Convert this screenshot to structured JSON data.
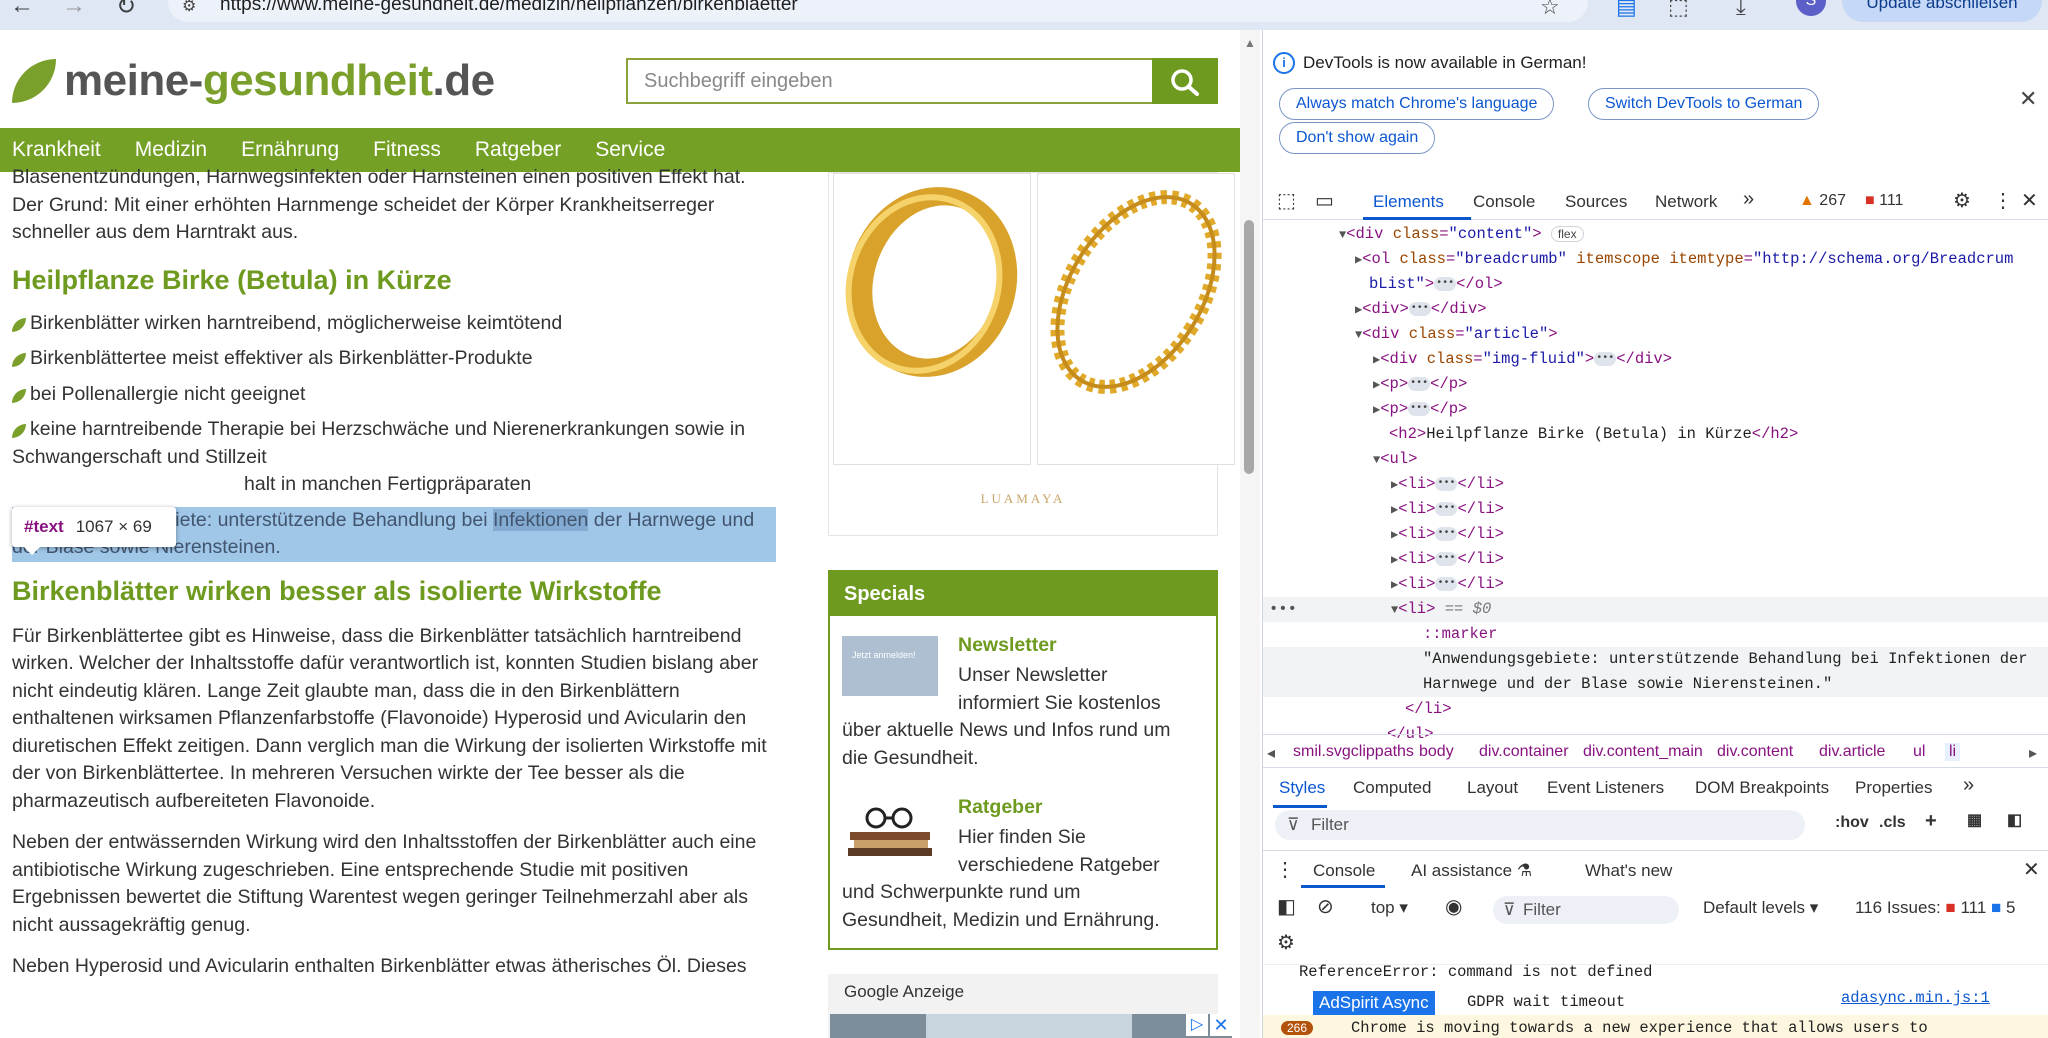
{
  "browser": {
    "url": "https://www.meine-gesundheit.de/medizin/heilpflanzen/birkenblaetter",
    "profile_initial": "S",
    "update_label": "Update abschließen"
  },
  "site": {
    "logo_a": "meine-",
    "logo_b": "gesundheit",
    "logo_c": ".de",
    "search_placeholder": "Suchbegriff eingeben",
    "nav": [
      "Krankheit",
      "Medizin",
      "Ernährung",
      "Fitness",
      "Ratgeber",
      "Service"
    ]
  },
  "article": {
    "intro_lines": [
      "Blasenentzündungen, Harnwegsinfekten oder Harnsteinen einen positiven Effekt hat.",
      "Der Grund: Mit einer erhöhten Harnmenge scheidet der Körper Krankheitserreger",
      "schneller aus dem Harntrakt aus."
    ],
    "h2_summary": "Heilpflanze Birke (Betula) in Kürze",
    "bullets": [
      "Birkenblätter wirken harntreibend, möglicherweise keimtötend",
      "Birkenblättertee meist effektiver als Birkenblätter-Produkte",
      "bei Pollenallergie nicht geeignet",
      "keine harntreibende Therapie bei Herzschwäche und Nierenerkrankungen sowie in",
      "Schwangerschaft und Stillzeit",
      "halt in manchen Fertigpräparaten"
    ],
    "highlighted_1_pre": "Anwendungsgebiete: unterstützende Behandlung bei ",
    "highlighted_1_word": "Infektionen",
    "highlighted_1_post": " der Harnwege und",
    "highlighted_2": "der Blase sowie Nierensteinen.",
    "h2_better": "Birkenblätter wirken besser als isolierte Wirkstoffe",
    "para1": [
      "Für Birkenblättertee gibt es Hinweise, dass die Birkenblätter tatsächlich harntreibend",
      "wirken. Welcher der Inhaltsstoffe dafür verantwortlich ist, konnten Studien bislang aber",
      "nicht eindeutig klären. Lange Zeit glaubte man, dass die in den Birkenblättern",
      "enthaltenen wirksamen Pflanzenfarbstoffe (Flavonoide) Hyperosid und Avicularin den",
      "diuretischen Effekt zeitigen. Dann verglich man die Wirkung der isolierten Wirkstoffe mit",
      "der von Birkenblättertee. In mehreren Versuchen wirkte der Tee besser als die",
      "pharmazeutisch aufbereiteten Flavonoide."
    ],
    "para2": [
      "Neben der entwässernden Wirkung wird den Inhaltsstoffen der Birkenblätter auch eine",
      "antibiotische Wirkung zugeschrieben. Eine entsprechende Studie mit positiven",
      "Ergebnissen bewertet die Stiftung Warentest wegen geringer Teilnehmerzahl aber als",
      "nicht aussagekräftig genug."
    ],
    "para3": "Neben Hyperosid und Avicularin enthalten Birkenblätter etwas ätherisches Öl. Dieses"
  },
  "tooltip": {
    "tag": "#text",
    "dims": "1067 × 69"
  },
  "sidebar": {
    "ad_brand": "LUAMAYA",
    "specials_title": "Specials",
    "newsletter_title": "Newsletter",
    "newsletter_thumb_text": "Jetzt anmelden!",
    "newsletter_text": [
      "Unser Newsletter",
      "informiert Sie kostenlos",
      "über aktuelle News und Infos rund um",
      "die Gesundheit."
    ],
    "ratgeber_title": "Ratgeber",
    "ratgeber_text": [
      "Hier finden Sie",
      "verschiedene Ratgeber",
      "und Schwerpunkte rund um",
      "Gesundheit, Medizin und Ernährung."
    ],
    "google_label": "Google Anzeige"
  },
  "devtools": {
    "info": "DevTools is now available in German!",
    "pill_1": "Always match Chrome's language",
    "pill_2": "Switch DevTools to German",
    "pill_3": "Don't show again",
    "tabs": [
      "Elements",
      "Console",
      "Sources",
      "Network"
    ],
    "warn_count": "267",
    "err_count": "111",
    "tree": {
      "l1_val": "\"content\"",
      "flex": "flex",
      "l2_val": "\"breadcrumb\"",
      "l2_type": "\"http://schema.org/Breadcrum",
      "l2b": "bList\"",
      "l4_val": "\"article\"",
      "l5_val": "\"img-fluid\"",
      "h2_text": "Heilpflanze Birke (Betula) in Kürze",
      "eq": "== $0",
      "marker": "::marker",
      "text1": "\"Anwendungsgebiete: unterstützende Behandlung bei Infektionen der",
      "text2": "Harnwege und der Blase sowie Nierensteinen.\""
    },
    "crumbs": [
      "smil.svgclippaths",
      "body",
      "div.container",
      "div.content_main",
      "div.content",
      "div.article",
      "ul",
      "li"
    ],
    "style_tabs": [
      "Styles",
      "Computed",
      "Layout",
      "Event Listeners",
      "DOM Breakpoints",
      "Properties"
    ],
    "filter": "Filter",
    "hov": ":hov",
    "cls": ".cls",
    "console_tabs": [
      "Console",
      "AI assistance",
      "What's new"
    ],
    "context": "top",
    "console_filter": "Filter",
    "levels": "Default levels",
    "issues_label": "116 Issues:",
    "issues_err": "111",
    "issues_info": "5",
    "msg1": "ReferenceError: command is not defined",
    "adspirit": "AdSpirit Async",
    "msg2": "GDPR wait timeout",
    "msg2_link": "adasync.min.js:1",
    "warn_badge": "266",
    "warn_text": "Chrome is moving towards a new experience that allows users to"
  }
}
